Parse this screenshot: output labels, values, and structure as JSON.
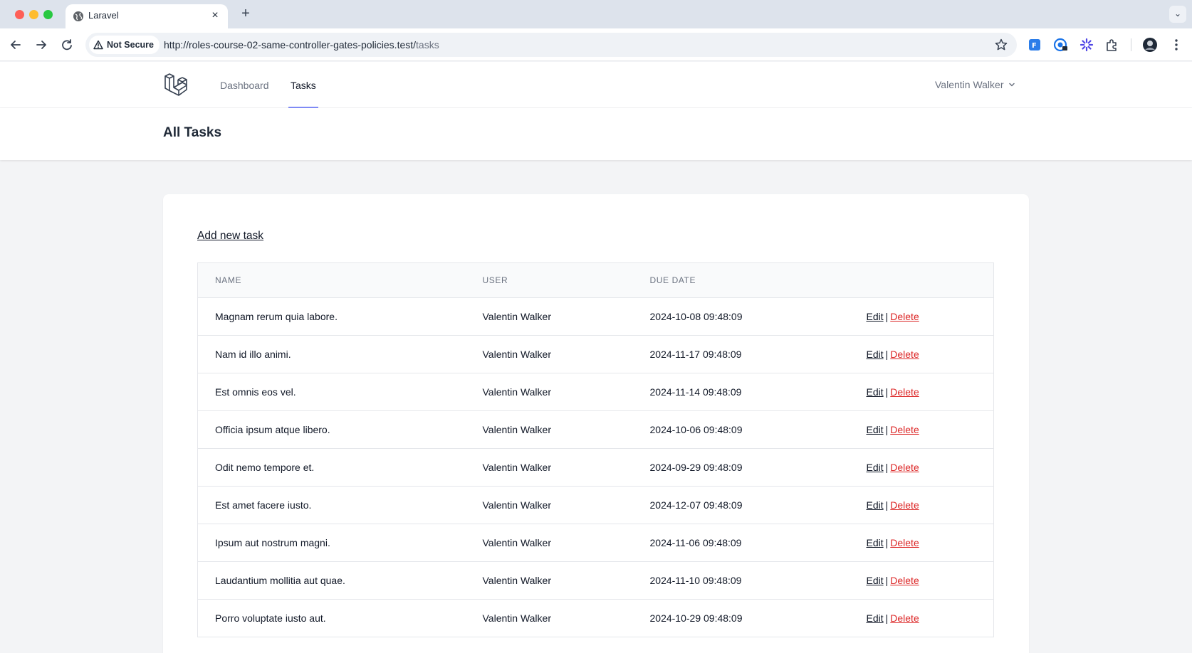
{
  "browser": {
    "tab_title": "Laravel",
    "close_glyph": "×",
    "new_tab_glyph": "+",
    "tab_menu_glyph": "⌄",
    "security_label": "Not Secure",
    "url_host": "http://roles-course-02-same-controller-gates-policies.test/",
    "url_path": "tasks"
  },
  "nav": {
    "links": [
      {
        "label": "Dashboard",
        "active": false
      },
      {
        "label": "Tasks",
        "active": true
      }
    ],
    "user_name": "Valentin Walker",
    "accent": "#818cf8"
  },
  "header": {
    "title": "All Tasks"
  },
  "tasks": {
    "add_label": "Add new task",
    "columns": [
      "NAME",
      "USER",
      "DUE DATE",
      ""
    ],
    "edit_label": "Edit",
    "delete_label": "Delete",
    "separator": "|",
    "delete_color": "#dc2626",
    "rows": [
      {
        "name": "Magnam rerum quia labore.",
        "user": "Valentin Walker",
        "due_date": "2024-10-08 09:48:09"
      },
      {
        "name": "Nam id illo animi.",
        "user": "Valentin Walker",
        "due_date": "2024-11-17 09:48:09"
      },
      {
        "name": "Est omnis eos vel.",
        "user": "Valentin Walker",
        "due_date": "2024-11-14 09:48:09"
      },
      {
        "name": "Officia ipsum atque libero.",
        "user": "Valentin Walker",
        "due_date": "2024-10-06 09:48:09"
      },
      {
        "name": "Odit nemo tempore et.",
        "user": "Valentin Walker",
        "due_date": "2024-09-29 09:48:09"
      },
      {
        "name": "Est amet facere iusto.",
        "user": "Valentin Walker",
        "due_date": "2024-12-07 09:48:09"
      },
      {
        "name": "Ipsum aut nostrum magni.",
        "user": "Valentin Walker",
        "due_date": "2024-11-06 09:48:09"
      },
      {
        "name": "Laudantium mollitia aut quae.",
        "user": "Valentin Walker",
        "due_date": "2024-11-10 09:48:09"
      },
      {
        "name": "Porro voluptate iusto aut.",
        "user": "Valentin Walker",
        "due_date": "2024-10-29 09:48:09"
      }
    ]
  }
}
